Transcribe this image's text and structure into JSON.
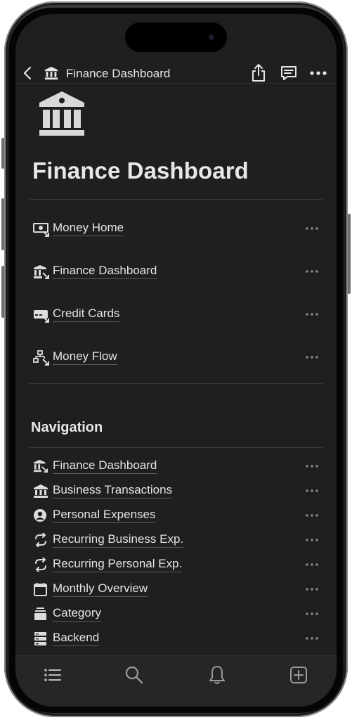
{
  "topbar": {
    "title": "Finance Dashboard",
    "icons": [
      "back-chevron-icon",
      "bank-icon",
      "share-icon",
      "comment-icon",
      "more-icon"
    ]
  },
  "page": {
    "icon": "bank-icon",
    "title": "Finance Dashboard"
  },
  "links": [
    {
      "label": "Money Home",
      "icon": "money-link-icon"
    },
    {
      "label": "Finance Dashboard",
      "icon": "bank-link-icon"
    },
    {
      "label": "Credit Cards",
      "icon": "credit-card-link-icon"
    },
    {
      "label": "Money Flow",
      "icon": "flowchart-link-icon"
    }
  ],
  "navigation": {
    "heading": "Navigation",
    "items": [
      {
        "label": "Finance Dashboard",
        "icon": "bank-link-icon"
      },
      {
        "label": "Business Transactions",
        "icon": "bank-icon"
      },
      {
        "label": "Personal Expenses",
        "icon": "person-circle-icon"
      },
      {
        "label": "Recurring Business Exp.",
        "icon": "repeat-icon"
      },
      {
        "label": "Recurring Personal Exp.",
        "icon": "repeat-icon"
      },
      {
        "label": "Monthly Overview",
        "icon": "calendar-icon"
      },
      {
        "label": "Category",
        "icon": "stack-icon"
      },
      {
        "label": "Backend",
        "icon": "server-icon"
      }
    ]
  },
  "tabbar": {
    "tabs": [
      "list-icon",
      "search-icon",
      "bell-icon",
      "new-page-icon"
    ]
  },
  "colors": {
    "background": "#1f1f1f",
    "text": "#e6e6e6",
    "muted": "#8a8a8a"
  }
}
